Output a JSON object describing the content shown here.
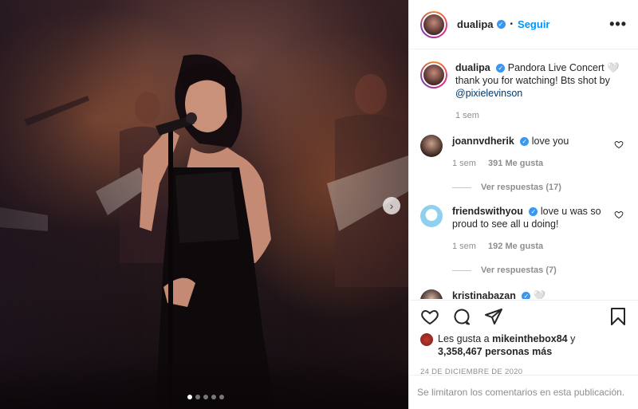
{
  "header": {
    "username": "dualipa",
    "verified_glyph": "✓",
    "separator": "•",
    "follow_label": "Seguir",
    "more_label": "•••"
  },
  "media": {
    "next_arrow": "›",
    "slide_count": 5,
    "current_slide": 1
  },
  "caption": {
    "username": "dualipa",
    "text": "Pandora Live Concert 🤍 thank you for watching! Bts shot by",
    "mention": "@pixielevinson",
    "time": "1 sem"
  },
  "comments": [
    {
      "username": "joannvdherik",
      "text": "love you",
      "time": "1 sem",
      "likes": "391 Me gusta",
      "replies": "Ver respuestas (17)"
    },
    {
      "username": "friendswithyou",
      "text": "love u was so proud to see all u doing!",
      "time": "1 sem",
      "likes": "192 Me gusta",
      "replies": "Ver respuestas (7)"
    },
    {
      "username": "kristinabazan",
      "text": "🤍"
    }
  ],
  "likes": {
    "prefix": "Les gusta a",
    "user": "mikeinthebox84",
    "connector": "y",
    "count": "3,358,467 personas más"
  },
  "date": "24 DE DICIEMBRE DE 2020",
  "comments_closed": "Se limitaron los comentarios en esta publicación.",
  "icons": {
    "like": "heart-icon",
    "comment": "comment-icon",
    "share": "share-icon",
    "save": "bookmark-icon",
    "verified": "verified-badge-icon",
    "more": "more-options-icon"
  },
  "colors": {
    "link": "#0095f6",
    "verified": "#3897f0",
    "muted": "#8e8e8e"
  }
}
